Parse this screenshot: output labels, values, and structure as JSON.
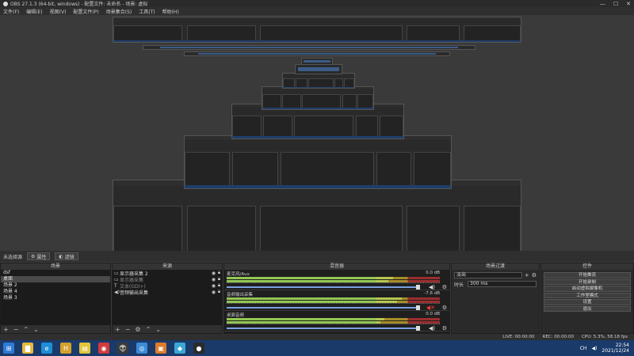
{
  "window": {
    "title": "OBS 27.1.3 (64-bit, windows) - 配置文件: 未命名 - 场景: 虚拟",
    "minimize": "—",
    "maximize": "☐",
    "close": "✕"
  },
  "menu": [
    "文件(F)",
    "编辑(E)",
    "视图(V)",
    "配置文件(P)",
    "场景集合(S)",
    "工具(T)",
    "帮助(H)"
  ],
  "scene_strip": {
    "current": "未选择源",
    "properties": "属性",
    "filters": "滤镜"
  },
  "scenes": {
    "header": "场景",
    "items": [
      "dsf",
      "桌面",
      "场景 2",
      "场景 4",
      "场景 3"
    ],
    "selected": 1
  },
  "sources": {
    "header": "来源",
    "items": [
      {
        "icon": "display-icon",
        "glyph": "▭",
        "label": "显示器采集 2",
        "dim": false
      },
      {
        "icon": "display-icon",
        "glyph": "▭",
        "label": "显示器采集",
        "dim": true
      },
      {
        "icon": "text-icon",
        "glyph": "T",
        "label": "文本(GDI+)",
        "dim": true
      },
      {
        "icon": "speaker-icon",
        "glyph": "◀)",
        "label": "音频输出采集",
        "dim": false
      }
    ]
  },
  "mixer": {
    "header": "混音器",
    "channels": [
      {
        "name": "麦克风/Aux",
        "db": "0.0 dB",
        "muted": false,
        "level": 0.78
      },
      {
        "name": "音频输出采集",
        "db": "-7.6 dB",
        "muted": true,
        "level": 0.82
      },
      {
        "name": "桌面音频",
        "db": "0.0 dB",
        "muted": false,
        "level": 0.74
      }
    ]
  },
  "transitions": {
    "header": "场景过渡",
    "type": "淡出",
    "duration_label": "时长",
    "duration": "300 ms"
  },
  "controls": {
    "header": "控件",
    "buttons": [
      "开始推流",
      "开始录制",
      "启动虚拟摄像机",
      "工作室模式",
      "设置",
      "退出"
    ]
  },
  "status": {
    "live": "LIVE: 00:00:00",
    "rec": "REC: 00:00:00",
    "cpu": "CPU: 5.3%, 58.18 fps"
  },
  "taskbar": {
    "icons": [
      {
        "name": "windows-start-icon",
        "glyph": "⊞",
        "color": "#2f7ad6"
      },
      {
        "name": "file-explorer-icon",
        "glyph": "▇",
        "color": "#e7b93a"
      },
      {
        "name": "edge-icon",
        "glyph": "e",
        "color": "#1e8fd6"
      },
      {
        "name": "app-icon-h",
        "glyph": "H",
        "color": "#d4a02a"
      },
      {
        "name": "notes-icon",
        "glyph": "▤",
        "color": "#e2c53a"
      },
      {
        "name": "netease-music-icon",
        "glyph": "◉",
        "color": "#d33b3b"
      },
      {
        "name": "alien-icon",
        "glyph": "👽",
        "color": "#3b3b3b"
      },
      {
        "name": "chrome-icon",
        "glyph": "◎",
        "color": "#3b8bd6"
      },
      {
        "name": "orange-app-icon",
        "glyph": "▣",
        "color": "#e07b2a"
      },
      {
        "name": "blue-app-icon",
        "glyph": "◆",
        "color": "#3ba7d6"
      },
      {
        "name": "obs-icon",
        "glyph": "●",
        "color": "#2b2b2b"
      }
    ],
    "lang": "CH",
    "time": "22:54",
    "date": "2021/12/24"
  }
}
